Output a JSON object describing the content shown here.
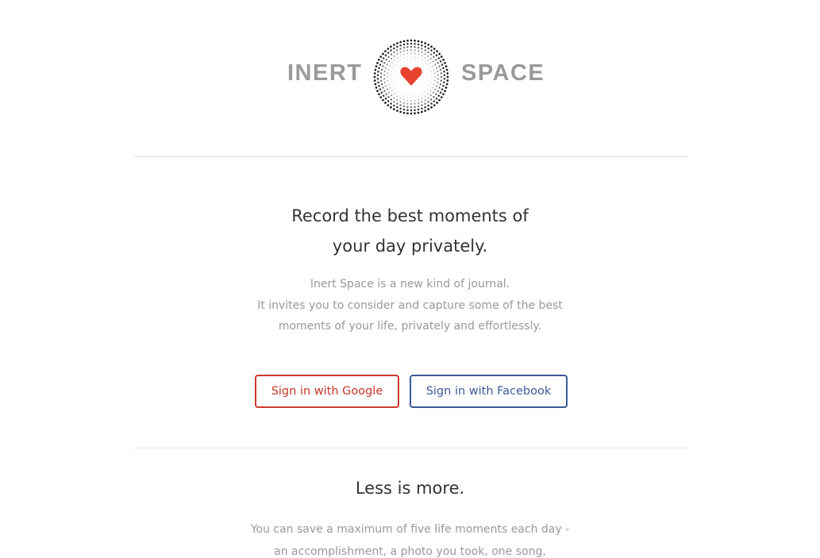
{
  "brand": {
    "word_left": "INERT",
    "word_right": "SPACE",
    "accent": "#e8432f",
    "dot_color": "#1a1a1a",
    "logo_icon": "heart-icon"
  },
  "hero": {
    "headline_line1": "Record the best moments of",
    "headline_line2": "your day privately.",
    "intro_line1": "Inert Space is a new kind of journal.",
    "intro_line2": "It invites you to consider and capture some of the best",
    "intro_line3": "moments of your life, privately and effortlessly."
  },
  "auth": {
    "google_label": "Sign in with Google",
    "google_color": "#cc3a2e",
    "facebook_label": "Sign in with Facebook",
    "facebook_color": "#3b5998"
  },
  "less_is_more": {
    "title": "Less is more.",
    "body_line1": "You can save a maximum of five life moments each day -",
    "body_line2": "an accomplishment, a photo you took, one song,"
  }
}
